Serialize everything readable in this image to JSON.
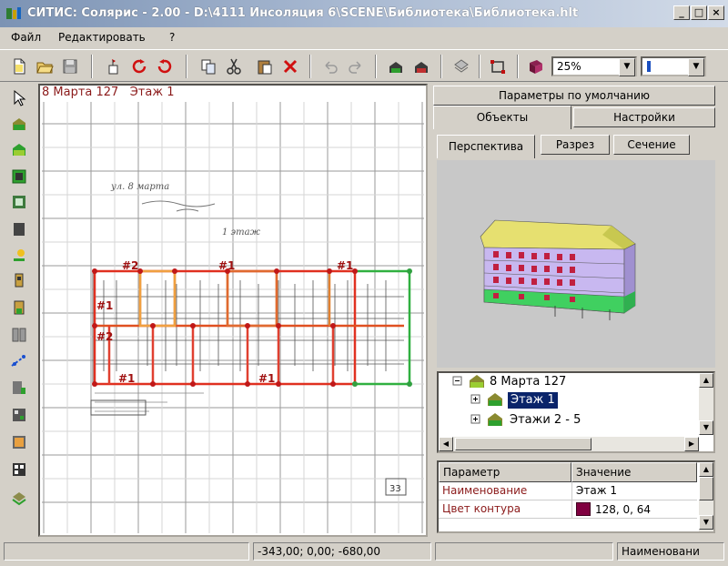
{
  "window": {
    "title": "СИТИС: Солярис - 2.00 - D:\\4111 Инсоляция 6\\SCENE\\Библиотека\\Библиотека.hlt",
    "minimize": "_",
    "maximize": "□",
    "close": "×"
  },
  "menu": [
    "Файл",
    "Редактировать",
    "?"
  ],
  "toolbar": {
    "zoom_value": "25%",
    "line_value": "",
    "icons": [
      "new-icon",
      "open-icon",
      "save-icon",
      "cursor-icon",
      "rotate-icon",
      "redo-icon",
      "copy-icon",
      "cut-icon",
      "paste-icon",
      "delete-icon",
      "undo-icon",
      "redo-arrow-icon",
      "building-icon",
      "building2-icon",
      "layers-icon",
      "frame-icon",
      "book-icon"
    ]
  },
  "canvas": {
    "header_building": "8 Марта 127",
    "header_floor": "Этаж 1",
    "handwriting_1": "ул. 8 марта",
    "handwriting_2": "1 этаж",
    "sheet_number": "33",
    "labels": [
      "#2",
      "#1",
      "#1",
      "#1",
      "#2",
      "#1",
      "#1"
    ]
  },
  "right_panel": {
    "tab_defaults": "Параметры по умолчанию",
    "tab_objects": "Объекты",
    "tab_settings": "Настройки",
    "view_perspective": "Перспектива",
    "view_section": "Разрез",
    "view_cut": "Сечение"
  },
  "tree": {
    "root": "8 Марта 127",
    "selected": "Этаж 1",
    "item2": "Этажи 2 - 5"
  },
  "props": {
    "col_param": "Параметр",
    "col_value": "Значение",
    "row1_name": "Наименование",
    "row1_value": "Этаж 1",
    "row2_name": "Цвет контура",
    "row2_value": "128, 0, 64",
    "contour_color": "#800040"
  },
  "status": {
    "coords": "-343,00; 0,00; -680,00",
    "hint": "Наименовани"
  }
}
